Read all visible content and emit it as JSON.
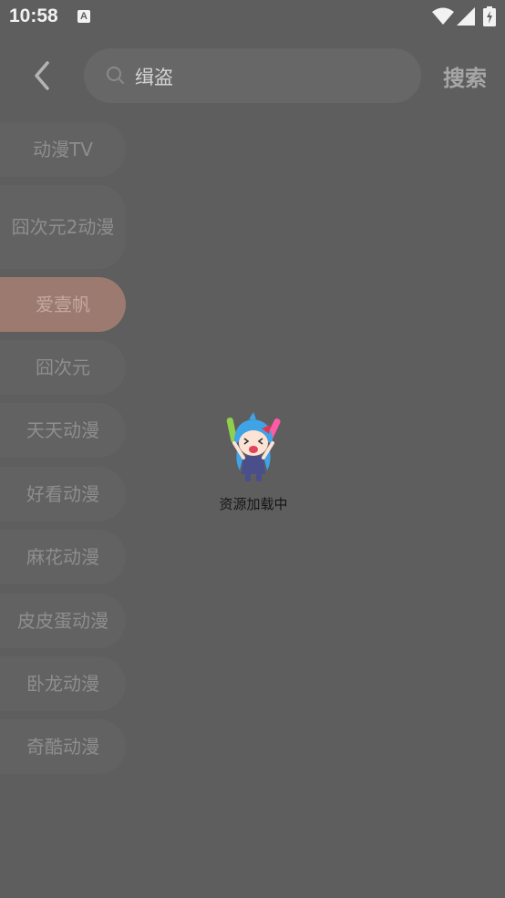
{
  "status_bar": {
    "time": "10:58",
    "notification_icon": "A"
  },
  "header": {
    "search_query": "缉盗",
    "search_button": "搜索"
  },
  "sources": [
    {
      "label": "动漫TV",
      "active": false
    },
    {
      "label": "囧次元2动漫",
      "active": false
    },
    {
      "label": "爱壹帆",
      "active": true
    },
    {
      "label": "囧次元",
      "active": false
    },
    {
      "label": "天天动漫",
      "active": false
    },
    {
      "label": "好看动漫",
      "active": false
    },
    {
      "label": "麻花动漫",
      "active": false
    },
    {
      "label": "皮皮蛋动漫",
      "active": false
    },
    {
      "label": "卧龙动漫",
      "active": false
    },
    {
      "label": "奇酷动漫",
      "active": false
    }
  ],
  "loading": {
    "text": "资源加载中"
  },
  "colors": {
    "background": "#5e5e5e",
    "active_source": "#9c7a6f",
    "text_dim": "#8e8e8e"
  }
}
